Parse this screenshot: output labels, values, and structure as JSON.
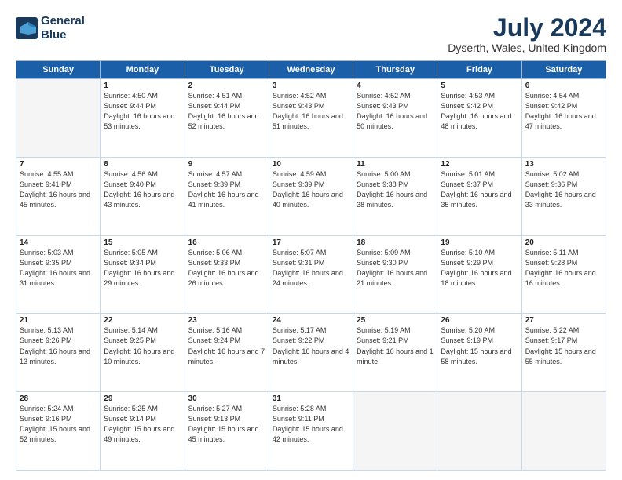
{
  "header": {
    "logo_line1": "General",
    "logo_line2": "Blue",
    "month_year": "July 2024",
    "location": "Dyserth, Wales, United Kingdom"
  },
  "days_of_week": [
    "Sunday",
    "Monday",
    "Tuesday",
    "Wednesday",
    "Thursday",
    "Friday",
    "Saturday"
  ],
  "weeks": [
    [
      {
        "day": "",
        "sunrise": "",
        "sunset": "",
        "daylight": ""
      },
      {
        "day": "1",
        "sunrise": "Sunrise: 4:50 AM",
        "sunset": "Sunset: 9:44 PM",
        "daylight": "Daylight: 16 hours and 53 minutes."
      },
      {
        "day": "2",
        "sunrise": "Sunrise: 4:51 AM",
        "sunset": "Sunset: 9:44 PM",
        "daylight": "Daylight: 16 hours and 52 minutes."
      },
      {
        "day": "3",
        "sunrise": "Sunrise: 4:52 AM",
        "sunset": "Sunset: 9:43 PM",
        "daylight": "Daylight: 16 hours and 51 minutes."
      },
      {
        "day": "4",
        "sunrise": "Sunrise: 4:52 AM",
        "sunset": "Sunset: 9:43 PM",
        "daylight": "Daylight: 16 hours and 50 minutes."
      },
      {
        "day": "5",
        "sunrise": "Sunrise: 4:53 AM",
        "sunset": "Sunset: 9:42 PM",
        "daylight": "Daylight: 16 hours and 48 minutes."
      },
      {
        "day": "6",
        "sunrise": "Sunrise: 4:54 AM",
        "sunset": "Sunset: 9:42 PM",
        "daylight": "Daylight: 16 hours and 47 minutes."
      }
    ],
    [
      {
        "day": "7",
        "sunrise": "Sunrise: 4:55 AM",
        "sunset": "Sunset: 9:41 PM",
        "daylight": "Daylight: 16 hours and 45 minutes."
      },
      {
        "day": "8",
        "sunrise": "Sunrise: 4:56 AM",
        "sunset": "Sunset: 9:40 PM",
        "daylight": "Daylight: 16 hours and 43 minutes."
      },
      {
        "day": "9",
        "sunrise": "Sunrise: 4:57 AM",
        "sunset": "Sunset: 9:39 PM",
        "daylight": "Daylight: 16 hours and 41 minutes."
      },
      {
        "day": "10",
        "sunrise": "Sunrise: 4:59 AM",
        "sunset": "Sunset: 9:39 PM",
        "daylight": "Daylight: 16 hours and 40 minutes."
      },
      {
        "day": "11",
        "sunrise": "Sunrise: 5:00 AM",
        "sunset": "Sunset: 9:38 PM",
        "daylight": "Daylight: 16 hours and 38 minutes."
      },
      {
        "day": "12",
        "sunrise": "Sunrise: 5:01 AM",
        "sunset": "Sunset: 9:37 PM",
        "daylight": "Daylight: 16 hours and 35 minutes."
      },
      {
        "day": "13",
        "sunrise": "Sunrise: 5:02 AM",
        "sunset": "Sunset: 9:36 PM",
        "daylight": "Daylight: 16 hours and 33 minutes."
      }
    ],
    [
      {
        "day": "14",
        "sunrise": "Sunrise: 5:03 AM",
        "sunset": "Sunset: 9:35 PM",
        "daylight": "Daylight: 16 hours and 31 minutes."
      },
      {
        "day": "15",
        "sunrise": "Sunrise: 5:05 AM",
        "sunset": "Sunset: 9:34 PM",
        "daylight": "Daylight: 16 hours and 29 minutes."
      },
      {
        "day": "16",
        "sunrise": "Sunrise: 5:06 AM",
        "sunset": "Sunset: 9:33 PM",
        "daylight": "Daylight: 16 hours and 26 minutes."
      },
      {
        "day": "17",
        "sunrise": "Sunrise: 5:07 AM",
        "sunset": "Sunset: 9:31 PM",
        "daylight": "Daylight: 16 hours and 24 minutes."
      },
      {
        "day": "18",
        "sunrise": "Sunrise: 5:09 AM",
        "sunset": "Sunset: 9:30 PM",
        "daylight": "Daylight: 16 hours and 21 minutes."
      },
      {
        "day": "19",
        "sunrise": "Sunrise: 5:10 AM",
        "sunset": "Sunset: 9:29 PM",
        "daylight": "Daylight: 16 hours and 18 minutes."
      },
      {
        "day": "20",
        "sunrise": "Sunrise: 5:11 AM",
        "sunset": "Sunset: 9:28 PM",
        "daylight": "Daylight: 16 hours and 16 minutes."
      }
    ],
    [
      {
        "day": "21",
        "sunrise": "Sunrise: 5:13 AM",
        "sunset": "Sunset: 9:26 PM",
        "daylight": "Daylight: 16 hours and 13 minutes."
      },
      {
        "day": "22",
        "sunrise": "Sunrise: 5:14 AM",
        "sunset": "Sunset: 9:25 PM",
        "daylight": "Daylight: 16 hours and 10 minutes."
      },
      {
        "day": "23",
        "sunrise": "Sunrise: 5:16 AM",
        "sunset": "Sunset: 9:24 PM",
        "daylight": "Daylight: 16 hours and 7 minutes."
      },
      {
        "day": "24",
        "sunrise": "Sunrise: 5:17 AM",
        "sunset": "Sunset: 9:22 PM",
        "daylight": "Daylight: 16 hours and 4 minutes."
      },
      {
        "day": "25",
        "sunrise": "Sunrise: 5:19 AM",
        "sunset": "Sunset: 9:21 PM",
        "daylight": "Daylight: 16 hours and 1 minute."
      },
      {
        "day": "26",
        "sunrise": "Sunrise: 5:20 AM",
        "sunset": "Sunset: 9:19 PM",
        "daylight": "Daylight: 15 hours and 58 minutes."
      },
      {
        "day": "27",
        "sunrise": "Sunrise: 5:22 AM",
        "sunset": "Sunset: 9:17 PM",
        "daylight": "Daylight: 15 hours and 55 minutes."
      }
    ],
    [
      {
        "day": "28",
        "sunrise": "Sunrise: 5:24 AM",
        "sunset": "Sunset: 9:16 PM",
        "daylight": "Daylight: 15 hours and 52 minutes."
      },
      {
        "day": "29",
        "sunrise": "Sunrise: 5:25 AM",
        "sunset": "Sunset: 9:14 PM",
        "daylight": "Daylight: 15 hours and 49 minutes."
      },
      {
        "day": "30",
        "sunrise": "Sunrise: 5:27 AM",
        "sunset": "Sunset: 9:13 PM",
        "daylight": "Daylight: 15 hours and 45 minutes."
      },
      {
        "day": "31",
        "sunrise": "Sunrise: 5:28 AM",
        "sunset": "Sunset: 9:11 PM",
        "daylight": "Daylight: 15 hours and 42 minutes."
      },
      {
        "day": "",
        "sunrise": "",
        "sunset": "",
        "daylight": ""
      },
      {
        "day": "",
        "sunrise": "",
        "sunset": "",
        "daylight": ""
      },
      {
        "day": "",
        "sunrise": "",
        "sunset": "",
        "daylight": ""
      }
    ]
  ]
}
